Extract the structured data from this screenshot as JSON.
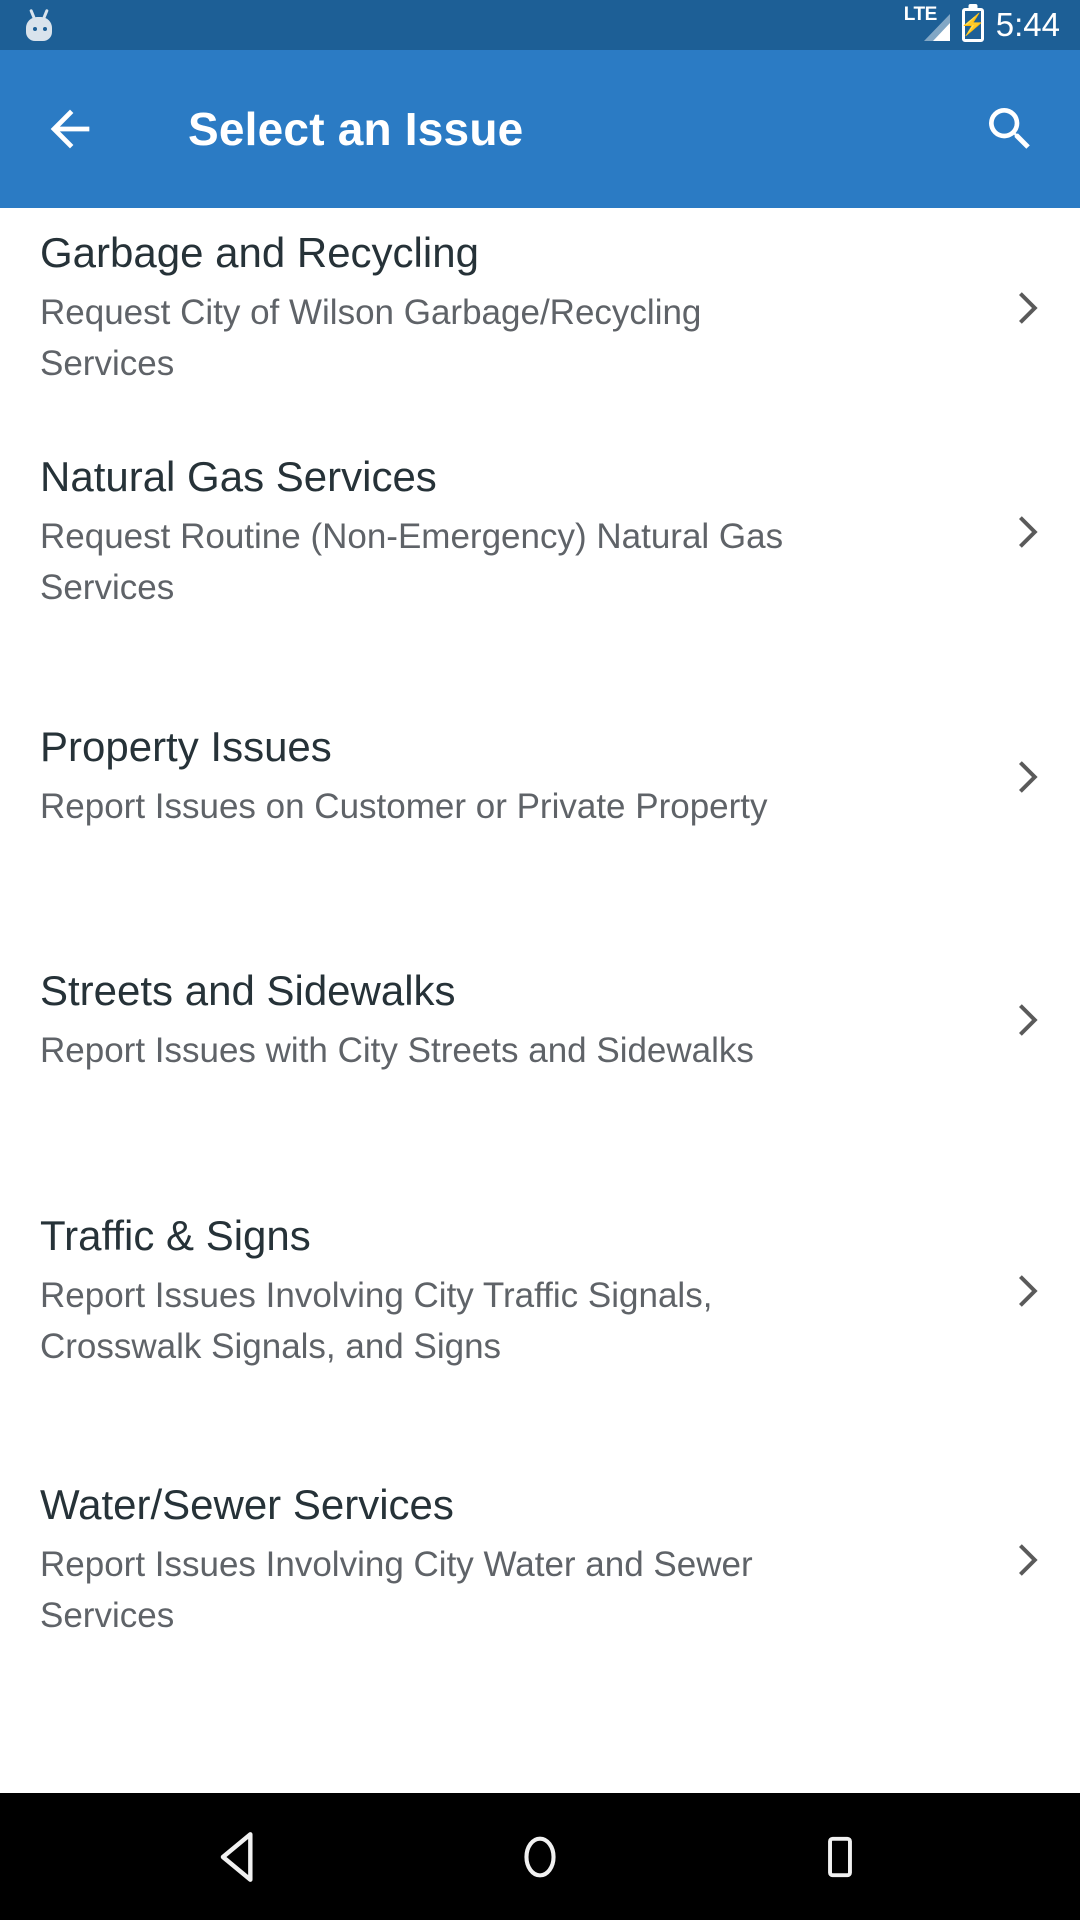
{
  "status_bar": {
    "notification_icon": "android-bugdroid-icon",
    "network_label": "LTE",
    "signal_icon": "signal-bars-icon",
    "battery_icon": "battery-charging-icon",
    "time": "5:44",
    "background_color": "#1d5f96"
  },
  "app_bar": {
    "back_icon": "arrow-back-icon",
    "title": "Select an Issue",
    "search_icon": "search-icon",
    "background_color": "#2b7bc4",
    "text_color": "#ffffff"
  },
  "list": {
    "items": [
      {
        "title": "Garbage and Recycling",
        "subtitle": "Request City of Wilson Garbage/Recycling Services",
        "chevron_icon": "chevron-right-icon"
      },
      {
        "title": "Natural Gas Services",
        "subtitle": "Request Routine (Non-Emergency) Natural Gas Services",
        "chevron_icon": "chevron-right-icon"
      },
      {
        "title": "Property Issues",
        "subtitle": "Report Issues on Customer or Private Property",
        "chevron_icon": "chevron-right-icon"
      },
      {
        "title": "Streets and Sidewalks",
        "subtitle": "Report Issues with City Streets and Sidewalks",
        "chevron_icon": "chevron-right-icon"
      },
      {
        "title": "Traffic & Signs",
        "subtitle": "Report Issues Involving City Traffic Signals, Crosswalk Signals, and Signs",
        "chevron_icon": "chevron-right-icon"
      },
      {
        "title": "Water/Sewer Services",
        "subtitle": "Report Issues Involving City Water and Sewer Services",
        "chevron_icon": "chevron-right-icon"
      }
    ],
    "title_color": "#263238",
    "subtitle_color": "#5f6368",
    "background_color": "#ffffff"
  },
  "nav_bar": {
    "back_icon": "nav-back-triangle-icon",
    "home_icon": "nav-home-circle-icon",
    "recents_icon": "nav-recents-square-icon",
    "background_color": "#000000"
  }
}
